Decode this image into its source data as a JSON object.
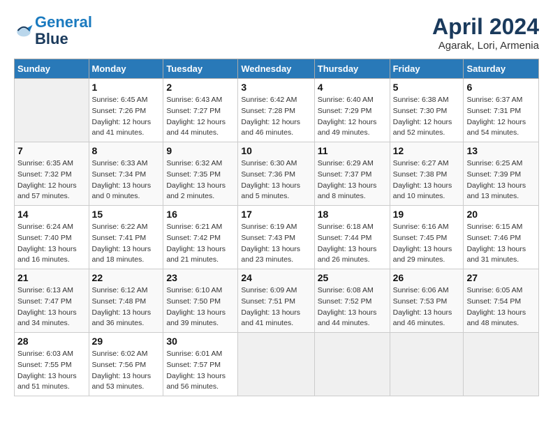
{
  "header": {
    "logo_line1": "General",
    "logo_line2": "Blue",
    "month_title": "April 2024",
    "location": "Agarak, Lori, Armenia"
  },
  "days_of_week": [
    "Sunday",
    "Monday",
    "Tuesday",
    "Wednesday",
    "Thursday",
    "Friday",
    "Saturday"
  ],
  "weeks": [
    [
      null,
      {
        "day": 1,
        "sunrise": "6:45 AM",
        "sunset": "7:26 PM",
        "daylight": "12 hours and 41 minutes."
      },
      {
        "day": 2,
        "sunrise": "6:43 AM",
        "sunset": "7:27 PM",
        "daylight": "12 hours and 44 minutes."
      },
      {
        "day": 3,
        "sunrise": "6:42 AM",
        "sunset": "7:28 PM",
        "daylight": "12 hours and 46 minutes."
      },
      {
        "day": 4,
        "sunrise": "6:40 AM",
        "sunset": "7:29 PM",
        "daylight": "12 hours and 49 minutes."
      },
      {
        "day": 5,
        "sunrise": "6:38 AM",
        "sunset": "7:30 PM",
        "daylight": "12 hours and 52 minutes."
      },
      {
        "day": 6,
        "sunrise": "6:37 AM",
        "sunset": "7:31 PM",
        "daylight": "12 hours and 54 minutes."
      }
    ],
    [
      {
        "day": 7,
        "sunrise": "6:35 AM",
        "sunset": "7:32 PM",
        "daylight": "12 hours and 57 minutes."
      },
      {
        "day": 8,
        "sunrise": "6:33 AM",
        "sunset": "7:34 PM",
        "daylight": "13 hours and 0 minutes."
      },
      {
        "day": 9,
        "sunrise": "6:32 AM",
        "sunset": "7:35 PM",
        "daylight": "13 hours and 2 minutes."
      },
      {
        "day": 10,
        "sunrise": "6:30 AM",
        "sunset": "7:36 PM",
        "daylight": "13 hours and 5 minutes."
      },
      {
        "day": 11,
        "sunrise": "6:29 AM",
        "sunset": "7:37 PM",
        "daylight": "13 hours and 8 minutes."
      },
      {
        "day": 12,
        "sunrise": "6:27 AM",
        "sunset": "7:38 PM",
        "daylight": "13 hours and 10 minutes."
      },
      {
        "day": 13,
        "sunrise": "6:25 AM",
        "sunset": "7:39 PM",
        "daylight": "13 hours and 13 minutes."
      }
    ],
    [
      {
        "day": 14,
        "sunrise": "6:24 AM",
        "sunset": "7:40 PM",
        "daylight": "13 hours and 16 minutes."
      },
      {
        "day": 15,
        "sunrise": "6:22 AM",
        "sunset": "7:41 PM",
        "daylight": "13 hours and 18 minutes."
      },
      {
        "day": 16,
        "sunrise": "6:21 AM",
        "sunset": "7:42 PM",
        "daylight": "13 hours and 21 minutes."
      },
      {
        "day": 17,
        "sunrise": "6:19 AM",
        "sunset": "7:43 PM",
        "daylight": "13 hours and 23 minutes."
      },
      {
        "day": 18,
        "sunrise": "6:18 AM",
        "sunset": "7:44 PM",
        "daylight": "13 hours and 26 minutes."
      },
      {
        "day": 19,
        "sunrise": "6:16 AM",
        "sunset": "7:45 PM",
        "daylight": "13 hours and 29 minutes."
      },
      {
        "day": 20,
        "sunrise": "6:15 AM",
        "sunset": "7:46 PM",
        "daylight": "13 hours and 31 minutes."
      }
    ],
    [
      {
        "day": 21,
        "sunrise": "6:13 AM",
        "sunset": "7:47 PM",
        "daylight": "13 hours and 34 minutes."
      },
      {
        "day": 22,
        "sunrise": "6:12 AM",
        "sunset": "7:48 PM",
        "daylight": "13 hours and 36 minutes."
      },
      {
        "day": 23,
        "sunrise": "6:10 AM",
        "sunset": "7:50 PM",
        "daylight": "13 hours and 39 minutes."
      },
      {
        "day": 24,
        "sunrise": "6:09 AM",
        "sunset": "7:51 PM",
        "daylight": "13 hours and 41 minutes."
      },
      {
        "day": 25,
        "sunrise": "6:08 AM",
        "sunset": "7:52 PM",
        "daylight": "13 hours and 44 minutes."
      },
      {
        "day": 26,
        "sunrise": "6:06 AM",
        "sunset": "7:53 PM",
        "daylight": "13 hours and 46 minutes."
      },
      {
        "day": 27,
        "sunrise": "6:05 AM",
        "sunset": "7:54 PM",
        "daylight": "13 hours and 48 minutes."
      }
    ],
    [
      {
        "day": 28,
        "sunrise": "6:03 AM",
        "sunset": "7:55 PM",
        "daylight": "13 hours and 51 minutes."
      },
      {
        "day": 29,
        "sunrise": "6:02 AM",
        "sunset": "7:56 PM",
        "daylight": "13 hours and 53 minutes."
      },
      {
        "day": 30,
        "sunrise": "6:01 AM",
        "sunset": "7:57 PM",
        "daylight": "13 hours and 56 minutes."
      },
      null,
      null,
      null,
      null
    ]
  ],
  "labels": {
    "sunrise": "Sunrise:",
    "sunset": "Sunset:",
    "daylight": "Daylight:"
  }
}
